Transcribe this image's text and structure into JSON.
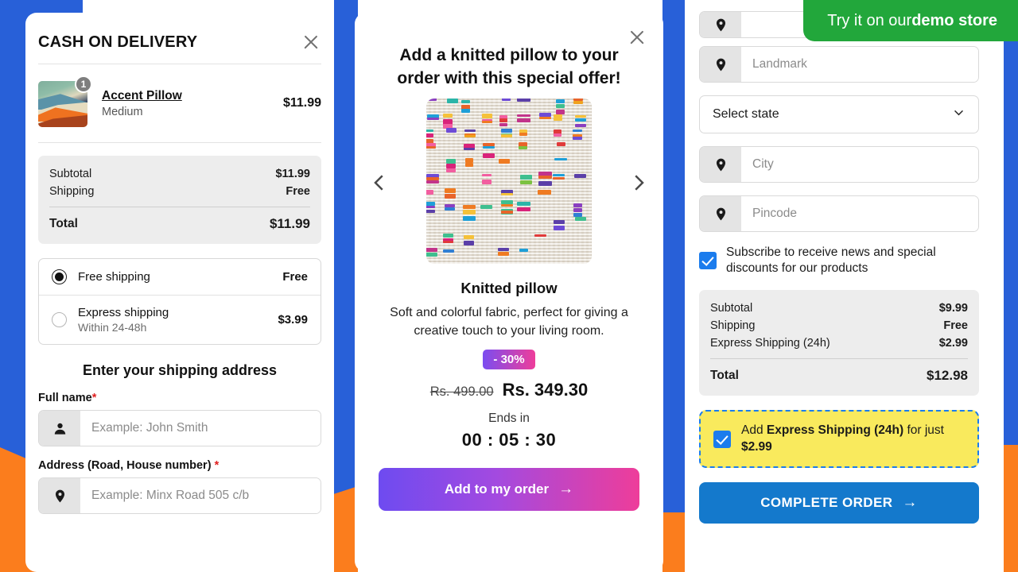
{
  "background": {
    "blue": "#2860d8",
    "orange": "#fb7d1d"
  },
  "ribbon": {
    "prefix": "Try it on our ",
    "emphasis": "demo store"
  },
  "left_panel": {
    "title": "CASH ON DELIVERY",
    "close_label": "Close",
    "cart_item": {
      "name": "Accent Pillow",
      "variant": "Medium",
      "price": "$11.99",
      "quantity": "1"
    },
    "summary": {
      "rows": [
        {
          "label": "Subtotal",
          "value": "$11.99"
        },
        {
          "label": "Shipping",
          "value": "Free"
        }
      ],
      "total_label": "Total",
      "total_value": "$11.99"
    },
    "shipping_options": [
      {
        "name": "Free shipping",
        "sub": "",
        "cost": "Free",
        "selected": true
      },
      {
        "name": "Express shipping",
        "sub": "Within 24-48h",
        "cost": "$3.99",
        "selected": false
      }
    ],
    "form": {
      "title": "Enter your shipping address",
      "fields": [
        {
          "label": "Full name",
          "required": "*",
          "placeholder": "Example: John Smith",
          "value": "",
          "icon": "person-icon"
        },
        {
          "label": "Address (Road, House number)",
          "required": "*",
          "placeholder": "Example: Minx Road 505 c/b",
          "value": "",
          "icon": "location-pin-icon"
        }
      ]
    }
  },
  "center_panel": {
    "close_label": "Close",
    "title": "Add a knitted pillow to your order with this special offer!",
    "carousel": {
      "prev_label": "Previous",
      "next_label": "Next"
    },
    "product": {
      "name": "Knitted pillow",
      "description": "Soft and colorful fabric, perfect for giving a creative touch to your living room.",
      "discount_badge": "- 30%",
      "price_original": "Rs. 499.00",
      "price_discounted": "Rs. 349.30"
    },
    "countdown": {
      "label": "Ends in",
      "value": "00 : 05 : 30"
    },
    "cta": {
      "label": "Add to my order",
      "arrow": "→"
    },
    "accent_gradient_from": "#6e4bf0",
    "accent_gradient_to": "#ee3d9a"
  },
  "right_panel": {
    "fields": [
      {
        "placeholder": "Landmark",
        "value": "",
        "icon": "location-pin-icon"
      },
      {
        "placeholder": "City",
        "value": "",
        "icon": "location-pin-icon"
      },
      {
        "placeholder": "Pincode",
        "value": "",
        "icon": "location-pin-icon"
      }
    ],
    "state_select": {
      "value": "Select state"
    },
    "subscribe": {
      "label": "Subscribe to receive news and special discounts for our products",
      "checked": true
    },
    "summary": {
      "rows": [
        {
          "label": "Subtotal",
          "value": "$9.99"
        },
        {
          "label": "Shipping",
          "value": "Free"
        },
        {
          "label": "Express Shipping (24h)",
          "value": "$2.99"
        }
      ],
      "total_label": "Total",
      "total_value": "$12.98"
    },
    "upsell": {
      "prefix": "Add ",
      "bold_service": "Express Shipping (24h)",
      "middle": " for just ",
      "bold_price": "$2.99",
      "checked": true,
      "bg_color": "#f9ea5d",
      "border_color": "#1b7ced"
    },
    "cta": {
      "label": "COMPLETE ORDER",
      "arrow": "→",
      "color": "#1479cc"
    }
  }
}
